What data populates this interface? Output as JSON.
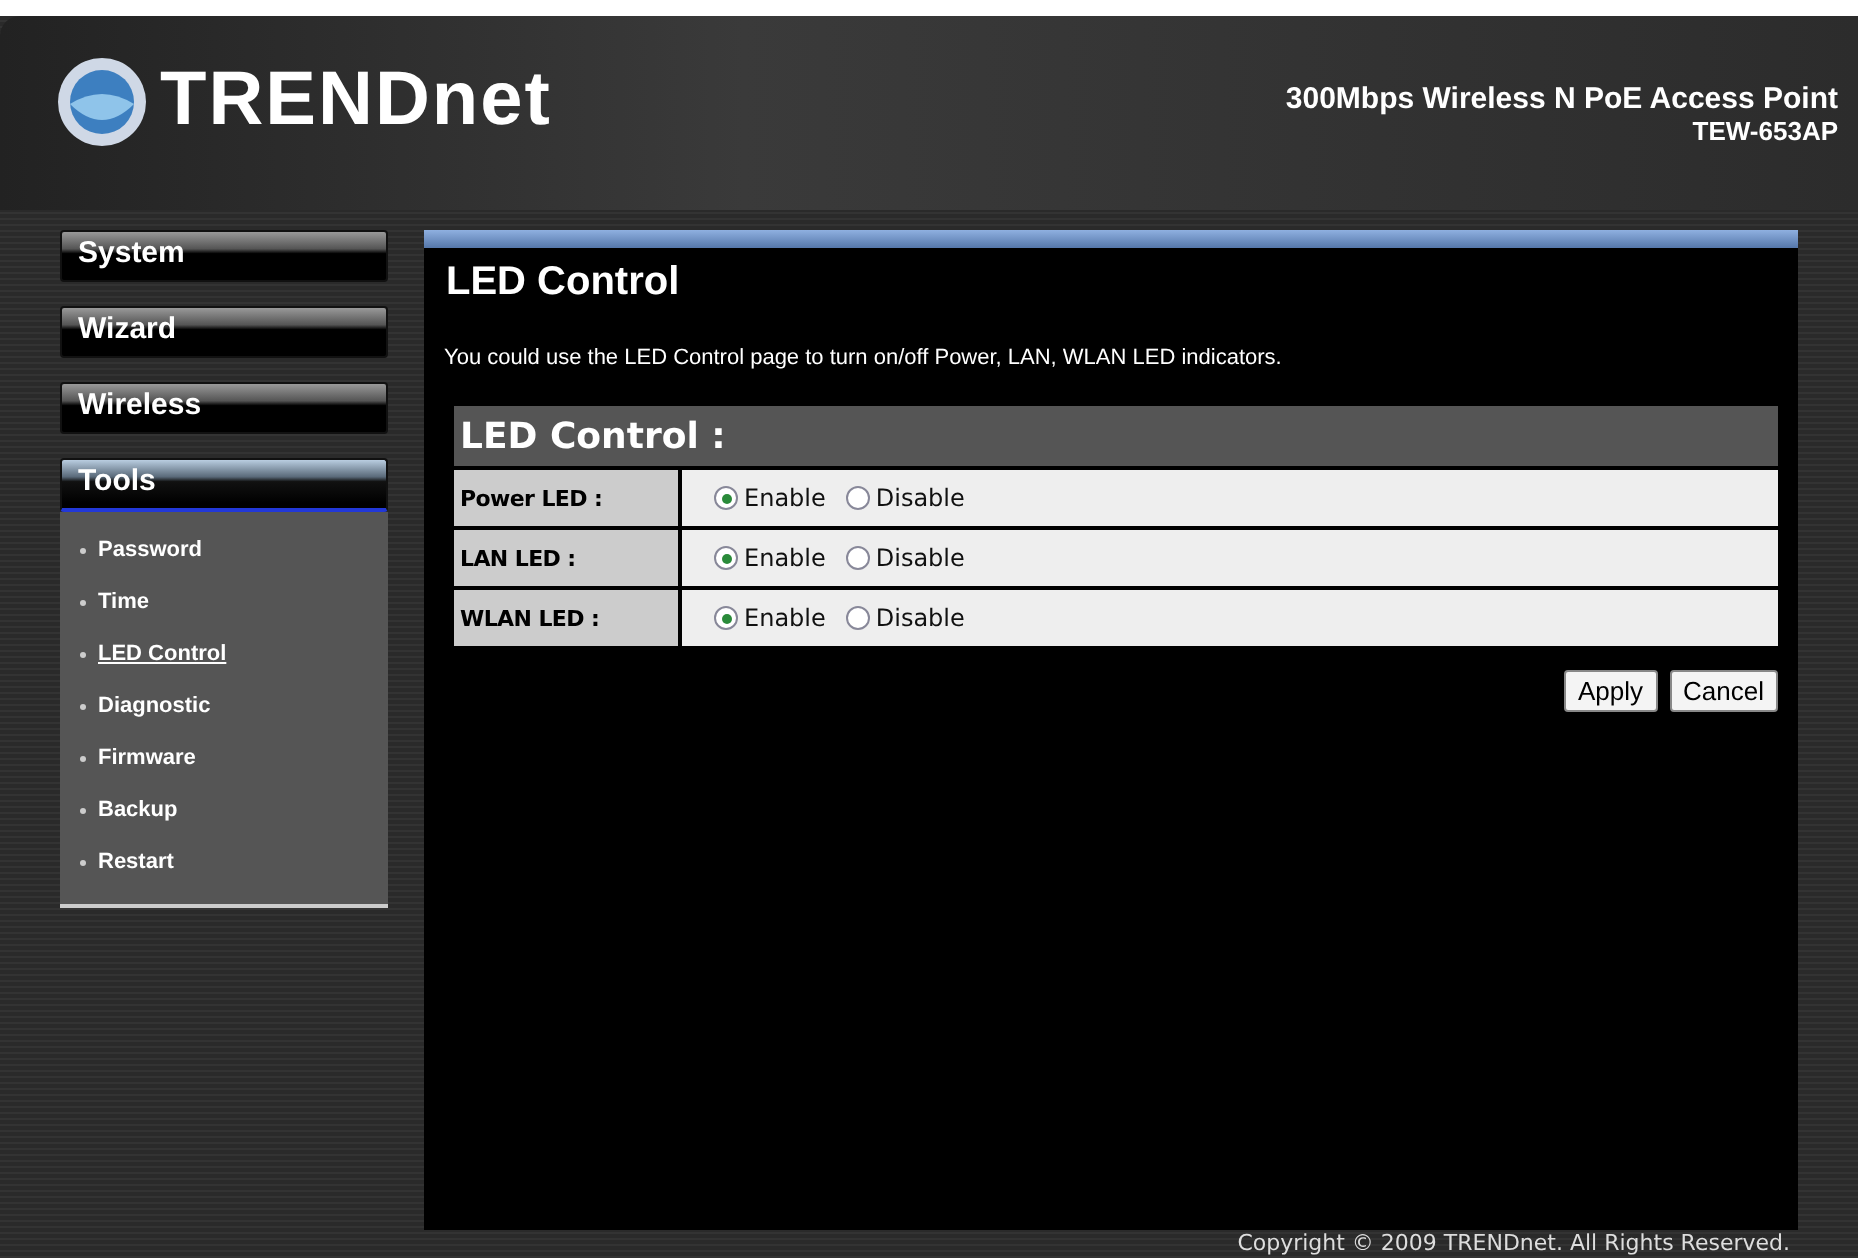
{
  "header": {
    "brand": "TRENDnet",
    "product": "300Mbps Wireless N PoE Access Point",
    "model": "TEW-653AP"
  },
  "sidebar": {
    "items": [
      {
        "label": "System",
        "selected": false
      },
      {
        "label": "Wizard",
        "selected": false
      },
      {
        "label": "Wireless",
        "selected": false
      },
      {
        "label": "Tools",
        "selected": true,
        "children": [
          {
            "label": "Password",
            "selected": false
          },
          {
            "label": "Time",
            "selected": false
          },
          {
            "label": "LED Control",
            "selected": true
          },
          {
            "label": "Diagnostic",
            "selected": false
          },
          {
            "label": "Firmware",
            "selected": false
          },
          {
            "label": "Backup",
            "selected": false
          },
          {
            "label": "Restart",
            "selected": false
          }
        ]
      }
    ]
  },
  "page": {
    "title": "LED Control",
    "description": "You could use the LED Control page to turn on/off Power, LAN, WLAN LED indicators.",
    "section_title": "LED Control :",
    "rows": [
      {
        "label": "Power LED :",
        "options": [
          {
            "label": "Enable",
            "selected": true
          },
          {
            "label": "Disable",
            "selected": false
          }
        ]
      },
      {
        "label": "LAN LED :",
        "options": [
          {
            "label": "Enable",
            "selected": true
          },
          {
            "label": "Disable",
            "selected": false
          }
        ]
      },
      {
        "label": "WLAN LED :",
        "options": [
          {
            "label": "Enable",
            "selected": true
          },
          {
            "label": "Disable",
            "selected": false
          }
        ]
      }
    ],
    "buttons": [
      "Apply",
      "Cancel"
    ]
  },
  "footer": "Copyright © 2009 TRENDnet. All Rights Reserved."
}
